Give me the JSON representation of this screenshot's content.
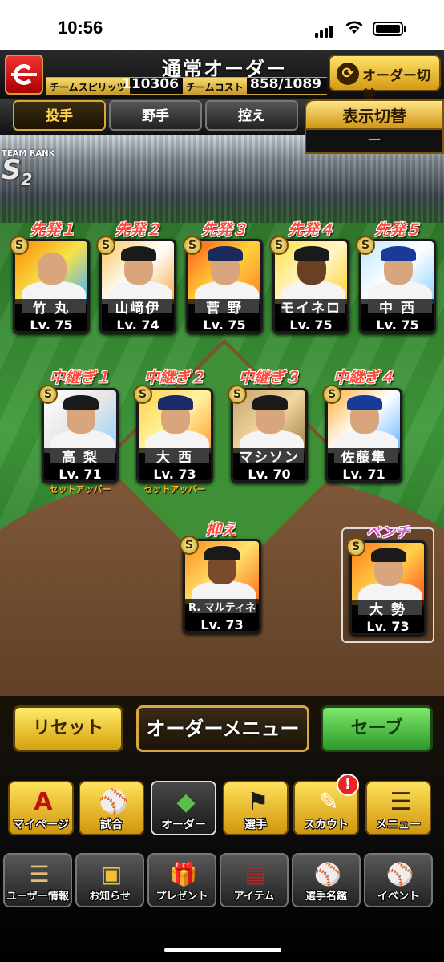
{
  "status_bar": {
    "time": "10:56"
  },
  "header": {
    "title": "通常オーダー",
    "team_spirit_label": "チームスピリッツ",
    "team_spirit_value": "110306",
    "team_cost_label": "チームコスト",
    "team_cost_value": "858/1089",
    "order_switch_label": "オーダー切替"
  },
  "tabs": [
    {
      "label": "投手"
    },
    {
      "label": "野手"
    },
    {
      "label": "控え"
    }
  ],
  "view_switch": {
    "label": "表示切替",
    "value": "ー"
  },
  "team_rank": {
    "label": "TEAM RANK",
    "rank": "S",
    "rank_sub": "2"
  },
  "starters": [
    {
      "position": "先発１",
      "name": "竹 丸",
      "level": "Lv. 75",
      "badge": "S"
    },
    {
      "position": "先発２",
      "name": "山﨑伊",
      "level": "Lv. 74",
      "badge": "S"
    },
    {
      "position": "先発３",
      "name": "菅 野",
      "level": "Lv. 75",
      "badge": "S"
    },
    {
      "position": "先発４",
      "name": "モイネロ",
      "level": "Lv. 75",
      "badge": "S"
    },
    {
      "position": "先発５",
      "name": "中 西",
      "level": "Lv. 75",
      "badge": "S"
    }
  ],
  "relievers": [
    {
      "position": "中継ぎ１",
      "name": "高 梨",
      "level": "Lv. 71",
      "badge": "S",
      "role": "セットアッパー"
    },
    {
      "position": "中継ぎ２",
      "name": "大 西",
      "level": "Lv. 73",
      "badge": "S",
      "role": "セットアッパー"
    },
    {
      "position": "中継ぎ３",
      "name": "マシソン",
      "level": "Lv. 70",
      "badge": "S",
      "role": ""
    },
    {
      "position": "中継ぎ４",
      "name": "佐藤隼",
      "level": "Lv. 71",
      "badge": "S",
      "role": ""
    }
  ],
  "closer": {
    "position": "抑え",
    "name": "R. マルティネス",
    "level": "Lv. 73",
    "badge": "S"
  },
  "bench": {
    "position": "ベンチ",
    "name": "大 勢",
    "level": "Lv. 73",
    "badge": "S"
  },
  "actions": {
    "reset": "リセット",
    "order_menu": "オーダーメニュー",
    "save": "セーブ"
  },
  "nav_primary": [
    {
      "label": "マイページ",
      "icon": "A"
    },
    {
      "label": "試合",
      "icon": "⚾"
    },
    {
      "label": "オーダー",
      "icon": "◆"
    },
    {
      "label": "選手",
      "icon": "⚑"
    },
    {
      "label": "スカウト",
      "icon": "✎"
    },
    {
      "label": "メニュー",
      "icon": "☰"
    }
  ],
  "scout_alert": "!",
  "nav_secondary": [
    {
      "label": "ユーザー情報",
      "icon": "☰"
    },
    {
      "label": "お知らせ",
      "icon": "▣"
    },
    {
      "label": "プレゼント",
      "icon": "🎁"
    },
    {
      "label": "アイテム",
      "icon": "▤"
    },
    {
      "label": "選手名鑑",
      "icon": "⚾"
    },
    {
      "label": "イベント",
      "icon": "⚾"
    }
  ],
  "colors": {
    "gold": "#d9a83a",
    "starter_red": "#ff4a3a",
    "bench_magenta": "#e04adb",
    "save_green": "#2e9a2a"
  }
}
